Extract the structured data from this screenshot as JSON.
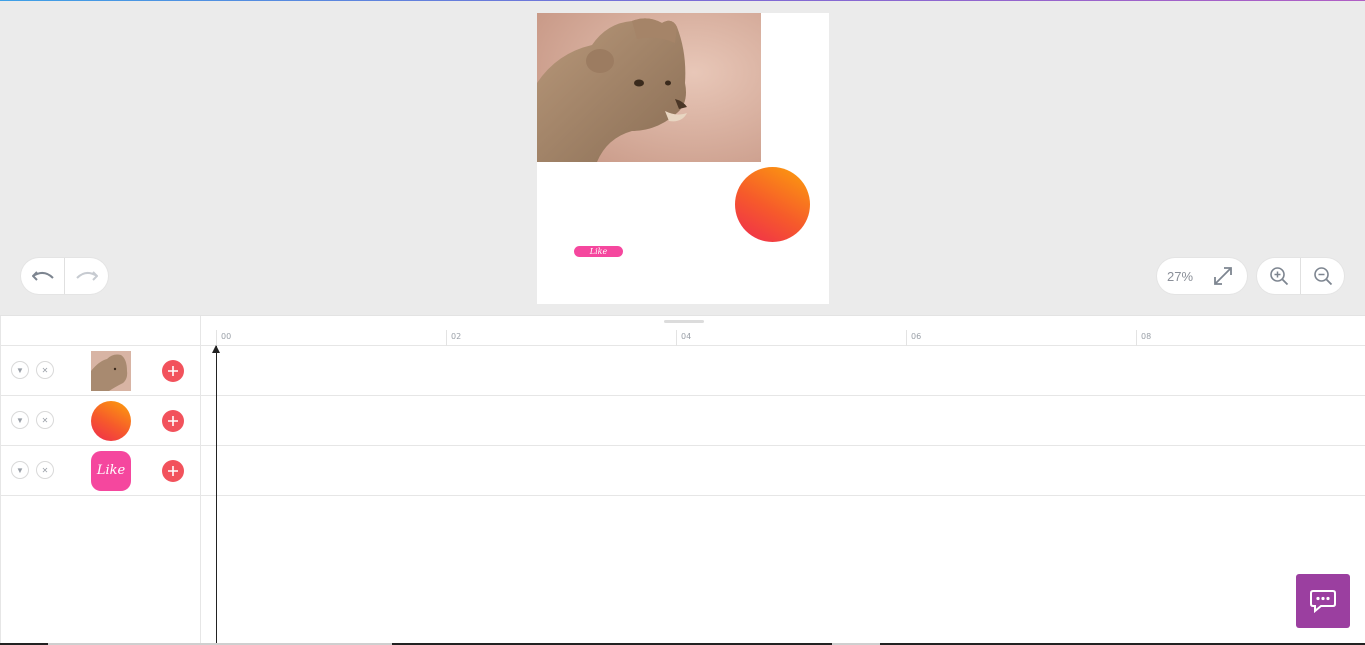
{
  "colors": {
    "canvas_bg": "#ebebeb",
    "add_button": "#f2525c",
    "chat_button": "#9b3fa0",
    "like_pill": "#f5479e",
    "circle_gradient": [
      "#ef2b4f",
      "#fca10b"
    ]
  },
  "artboard": {
    "photo_icon": "lioness-photo",
    "circle_icon": "gradient-circle",
    "like_label": "Like"
  },
  "toolbar": {
    "undo_icon": "undo-icon",
    "redo_icon": "redo-icon",
    "zoom_level": "27%",
    "fit_icon": "expand-icon",
    "zoom_in_icon": "zoom-in-icon",
    "zoom_out_icon": "zoom-out-icon"
  },
  "timeline": {
    "ruler_ticks": [
      "00",
      "02",
      "04",
      "06",
      "08"
    ],
    "layers": [
      {
        "thumbnail": "lioness-photo",
        "collapse_icon": "triangle-down-icon",
        "remove_icon": "close-icon",
        "add_icon": "plus-icon"
      },
      {
        "thumbnail": "gradient-circle",
        "collapse_icon": "triangle-down-icon",
        "remove_icon": "close-icon",
        "add_icon": "plus-icon"
      },
      {
        "thumbnail": "like-sticker",
        "thumbnail_text": "Like",
        "collapse_icon": "triangle-down-icon",
        "remove_icon": "close-icon",
        "add_icon": "plus-icon"
      }
    ]
  },
  "chat": {
    "icon": "chat-bubble-icon"
  }
}
